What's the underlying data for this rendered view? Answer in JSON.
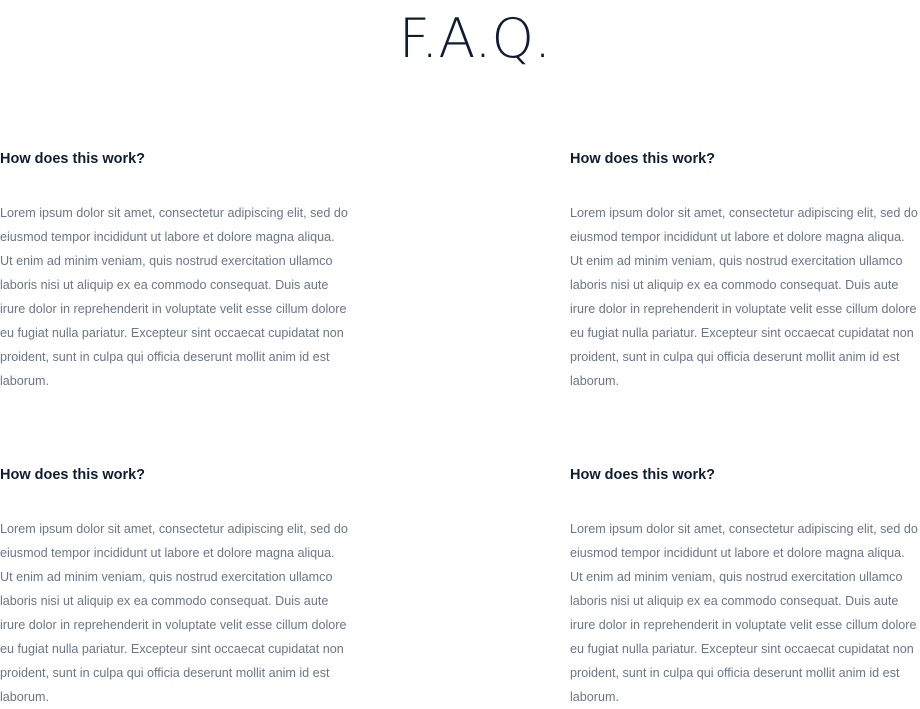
{
  "page": {
    "title": "F.A.Q."
  },
  "faq": {
    "items": [
      {
        "question": "How does this work?",
        "answer": "Lorem ipsum dolor sit amet, consectetur adipiscing elit, sed do eiusmod tempor incididunt ut labore et dolore magna aliqua. Ut enim ad minim veniam, quis nostrud exercitation ullamco laboris nisi ut aliquip ex ea commodo consequat. Duis aute irure dolor in reprehenderit in voluptate velit esse cillum dolore eu fugiat nulla pariatur. Excepteur sint occaecat cupidatat non proident, sunt in culpa qui officia deserunt mollit anim id est laborum."
      },
      {
        "question": "How does this work?",
        "answer": "Lorem ipsum dolor sit amet, consectetur adipiscing elit, sed do eiusmod tempor incididunt ut labore et dolore magna aliqua. Ut enim ad minim veniam, quis nostrud exercitation ullamco laboris nisi ut aliquip ex ea commodo consequat. Duis aute irure dolor in reprehenderit in voluptate velit esse cillum dolore eu fugiat nulla pariatur. Excepteur sint occaecat cupidatat non proident, sunt in culpa qui officia deserunt mollit anim id est laborum."
      },
      {
        "question": "How does this work?",
        "answer": "Lorem ipsum dolor sit amet, consectetur adipiscing elit, sed do eiusmod tempor incididunt ut labore et dolore magna aliqua. Ut enim ad minim veniam, quis nostrud exercitation ullamco laboris nisi ut aliquip ex ea commodo consequat. Duis aute irure dolor in reprehenderit in voluptate velit esse cillum dolore eu fugiat nulla pariatur. Excepteur sint occaecat cupidatat non proident, sunt in culpa qui officia deserunt mollit anim id est laborum."
      },
      {
        "question": "How does this work?",
        "answer": "Lorem ipsum dolor sit amet, consectetur adipiscing elit, sed do eiusmod tempor incididunt ut labore et dolore magna aliqua. Ut enim ad minim veniam, quis nostrud exercitation ullamco laboris nisi ut aliquip ex ea commodo consequat. Duis aute irure dolor in reprehenderit in voluptate velit esse cillum dolore eu fugiat nulla pariatur. Excepteur sint occaecat cupidatat non proident, sunt in culpa qui officia deserunt mollit anim id est laborum."
      }
    ]
  }
}
